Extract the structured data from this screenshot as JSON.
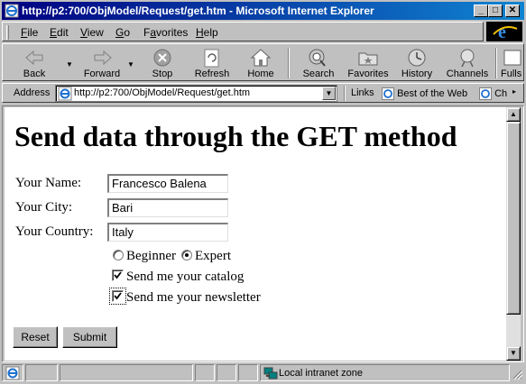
{
  "window": {
    "title": "http://p2:700/ObjModel/Request/get.htm - Microsoft Internet Explorer",
    "minimize_glyph": "_",
    "maximize_glyph": "□",
    "close_glyph": "✕"
  },
  "menu": [
    "File",
    "Edit",
    "View",
    "Go",
    "Favorites",
    "Help"
  ],
  "menu_underline": [
    "F",
    "E",
    "V",
    "G",
    "a",
    "H"
  ],
  "toolbar": {
    "back": "Back",
    "forward": "Forward",
    "stop": "Stop",
    "refresh": "Refresh",
    "home": "Home",
    "search": "Search",
    "favorites": "Favorites",
    "history": "History",
    "channels": "Channels",
    "fullscreen": "Fulls"
  },
  "addressbar": {
    "label": "Address",
    "url": "http://p2:700/ObjModel/Request/get.htm",
    "links_label": "Links",
    "link1": "Best of the Web",
    "link2": "Ch"
  },
  "page": {
    "title": "Send data through the GET method",
    "name_label": "Your Name:",
    "name_value": "Francesco Balena",
    "city_label": "Your City:",
    "city_value": "Bari",
    "country_label": "Your Country:",
    "country_value": "Italy",
    "level_beginner": "Beginner",
    "level_expert": "Expert",
    "level_selected": "Expert",
    "catalog_label": "Send me your catalog",
    "catalog_checked": true,
    "newsletter_label": "Send me your newsletter",
    "newsletter_checked": true,
    "reset_label": "Reset",
    "submit_label": "Submit"
  },
  "status": {
    "zone": "Local intranet zone"
  },
  "colors": {
    "titlebar_start": "#000080",
    "titlebar_end": "#1084d0",
    "chrome": "#c0c0c0"
  }
}
